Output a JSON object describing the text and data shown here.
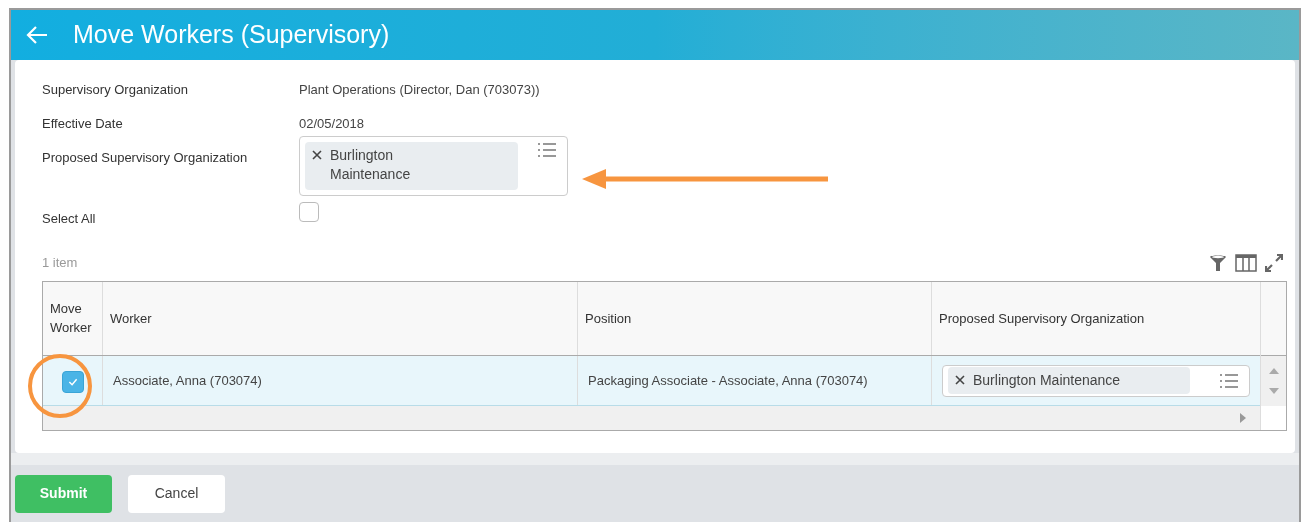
{
  "header": {
    "title": "Move Workers (Supervisory)"
  },
  "fields": [
    {
      "kind": "text",
      "label": "Supervisory Organization",
      "value": "Plant Operations (Director, Dan (703073))"
    },
    {
      "kind": "text",
      "label": "Effective Date",
      "value": "02/05/2018"
    },
    {
      "kind": "multiselect",
      "label": "Proposed Supervisory Organization",
      "tags": [
        "Burlington Maintenance"
      ]
    },
    {
      "kind": "checkbox",
      "label": "Select All",
      "checked": false
    }
  ],
  "item_count": "1 item",
  "table": {
    "columns": [
      "Move Worker",
      "Worker",
      "Position",
      "Proposed Supervisory Organization"
    ],
    "rows": [
      {
        "checked": true,
        "worker": "Associate, Anna (703074)",
        "position": "Packaging Associate - Associate, Anna (703074)",
        "organization_tags": [
          "Burlington Maintenance"
        ]
      }
    ]
  },
  "buttons": [
    {
      "label": "Submit",
      "kind": "primary"
    },
    {
      "label": "Cancel",
      "kind": "secondary"
    }
  ]
}
